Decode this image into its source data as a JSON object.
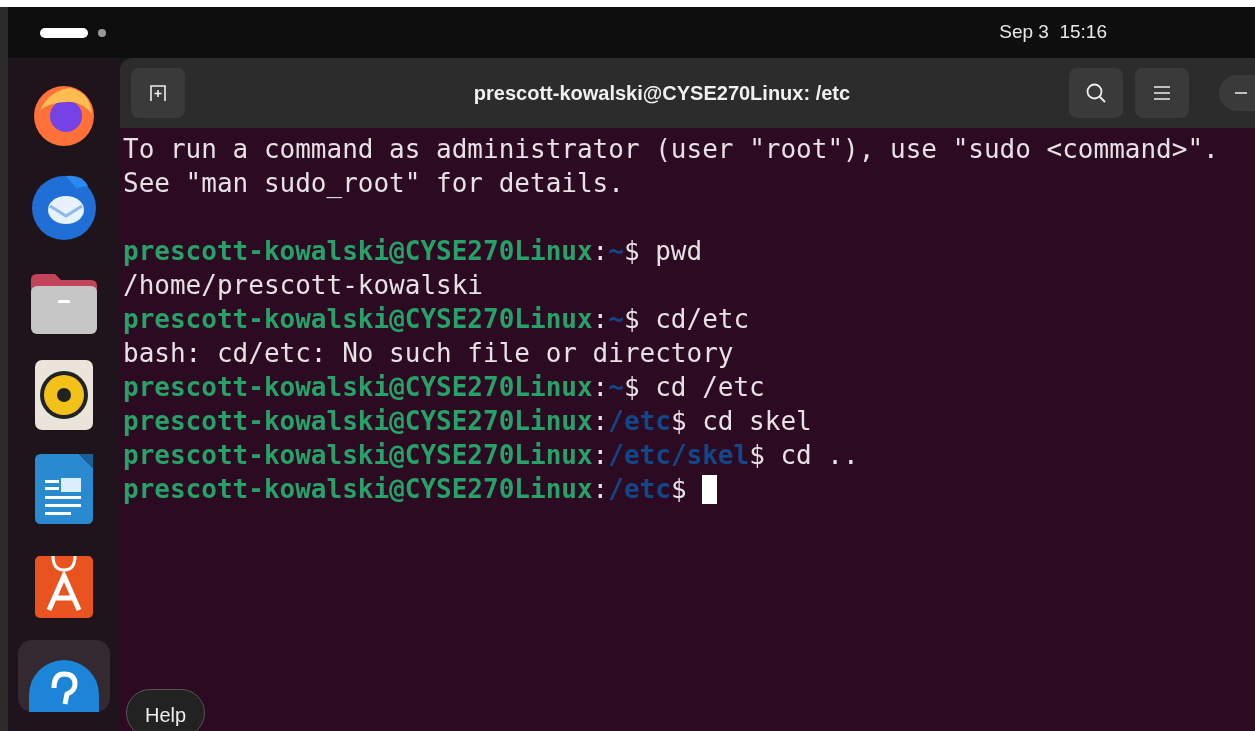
{
  "top_bar": {
    "clock": "Sep 3  15:16"
  },
  "dock": {
    "items": [
      {
        "kind": "browser",
        "selected": false
      },
      {
        "kind": "mail",
        "selected": false
      },
      {
        "kind": "files",
        "selected": false
      },
      {
        "kind": "music",
        "selected": false
      },
      {
        "kind": "writer",
        "selected": false
      },
      {
        "kind": "store",
        "selected": false
      },
      {
        "kind": "help",
        "selected": true
      }
    ],
    "tooltip": "Help"
  },
  "window": {
    "title": "prescott-kowalski@CYSE270Linux: /etc"
  },
  "terminal": {
    "lines": [
      {
        "kind": "output",
        "text": "To run a command as administrator (user \"root\"), use \"sudo <command>\"."
      },
      {
        "kind": "output",
        "text": "See \"man sudo_root\" for details."
      },
      {
        "kind": "blank"
      },
      {
        "kind": "prompt",
        "user": "prescott-kowalski@CYSE270Linux",
        "separator": ":",
        "path": "~",
        "symbol": "$",
        "command": "pwd"
      },
      {
        "kind": "output",
        "text": "/home/prescott-kowalski"
      },
      {
        "kind": "prompt",
        "user": "prescott-kowalski@CYSE270Linux",
        "separator": ":",
        "path": "~",
        "symbol": "$",
        "command": "cd/etc"
      },
      {
        "kind": "output",
        "text": "bash: cd/etc: No such file or directory"
      },
      {
        "kind": "prompt",
        "user": "prescott-kowalski@CYSE270Linux",
        "separator": ":",
        "path": "~",
        "symbol": "$",
        "command": "cd /etc"
      },
      {
        "kind": "prompt",
        "user": "prescott-kowalski@CYSE270Linux",
        "separator": ":",
        "path": "/etc",
        "symbol": "$",
        "command": "cd skel"
      },
      {
        "kind": "prompt",
        "user": "prescott-kowalski@CYSE270Linux",
        "separator": ":",
        "path": "/etc/skel",
        "symbol": "$",
        "command": "cd .."
      },
      {
        "kind": "prompt",
        "user": "prescott-kowalski@CYSE270Linux",
        "separator": ":",
        "path": "/etc",
        "symbol": "$",
        "cursor": true
      }
    ]
  }
}
